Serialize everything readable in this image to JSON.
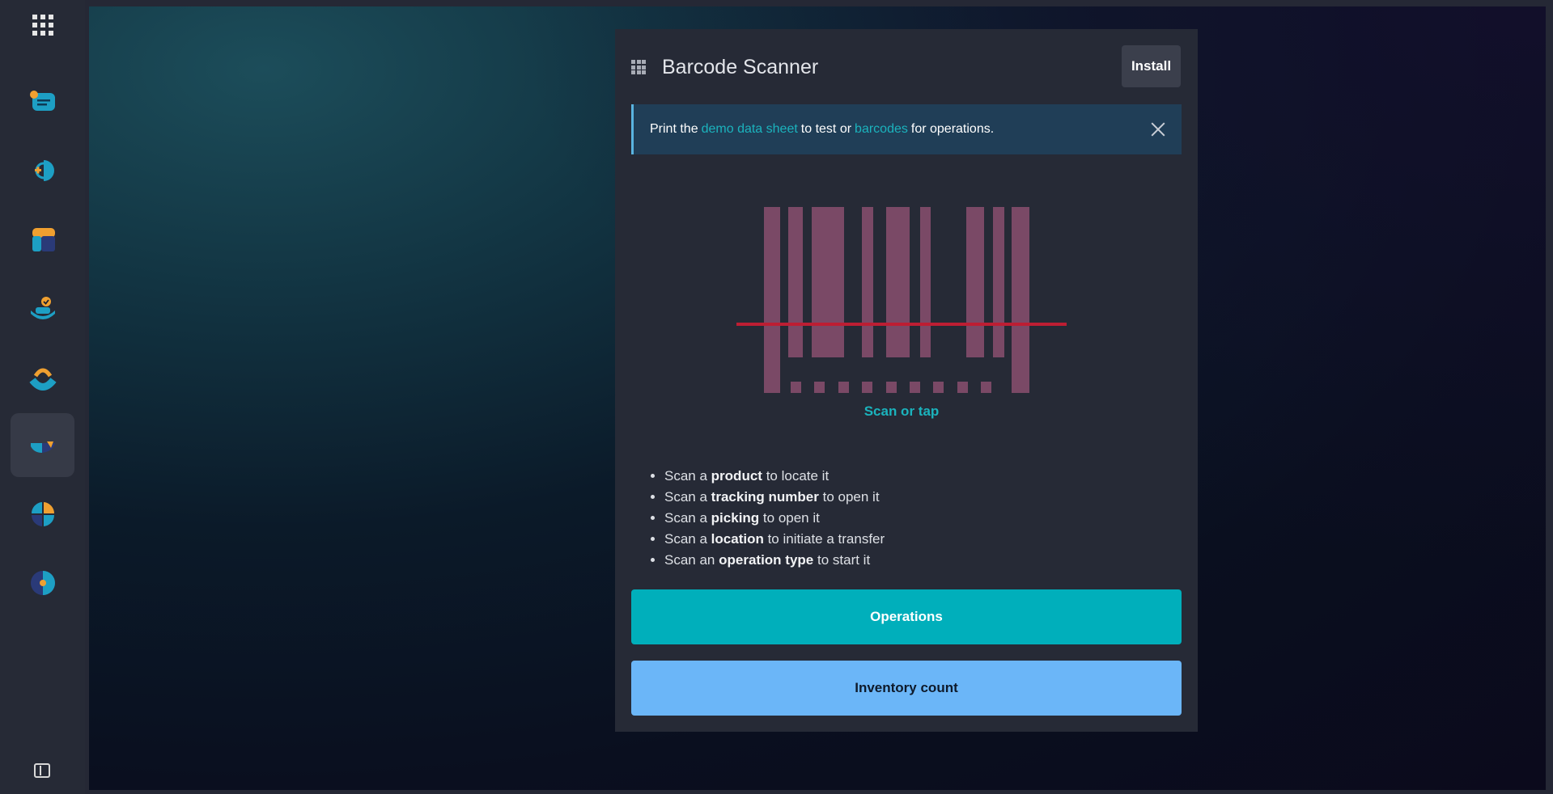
{
  "sidebar": {
    "apps_icon": "apps-grid-icon",
    "apps": [
      {
        "name": "discuss-app",
        "icon": "chat-bubble-icon",
        "active": false
      },
      {
        "name": "add-app",
        "icon": "plus-circle-icon",
        "active": false
      },
      {
        "name": "dashboard-app",
        "icon": "dashboard-icon",
        "active": false
      },
      {
        "name": "approvals-app",
        "icon": "check-badge-icon",
        "active": false
      },
      {
        "name": "support-app",
        "icon": "headset-icon",
        "active": false
      },
      {
        "name": "inventory-app",
        "icon": "box-icon",
        "active": true
      },
      {
        "name": "planning-app",
        "icon": "quadrant-icon",
        "active": false
      },
      {
        "name": "reports-app",
        "icon": "pie-icon",
        "active": false
      }
    ],
    "panel_toggle_icon": "sidebar-toggle-icon"
  },
  "window": {
    "title": "Barcode Scanner",
    "install_label": "Install"
  },
  "alert": {
    "text_1": "Print the",
    "link_1": "demo data sheet",
    "text_2": "to test or",
    "link_2": "barcodes",
    "text_3": "for operations."
  },
  "scanner": {
    "label": "Scan or tap"
  },
  "tips": [
    {
      "pre": "Scan a",
      "bold": "product",
      "post": "to locate it"
    },
    {
      "pre": "Scan a",
      "bold": "tracking number",
      "post": "to open it"
    },
    {
      "pre": "Scan a",
      "bold": "picking",
      "post": "to open it"
    },
    {
      "pre": "Scan a",
      "bold": "location",
      "post": "to initiate a transfer"
    },
    {
      "pre": "Scan an",
      "bold": "operation type",
      "post": "to start it"
    }
  ],
  "buttons": {
    "operations": "Operations",
    "inventory": "Inventory count"
  },
  "colors": {
    "accent": "#00afbb",
    "secondary": "#6bb6f8",
    "barcode": "#7a4966",
    "scan_line": "#bd1e33"
  }
}
